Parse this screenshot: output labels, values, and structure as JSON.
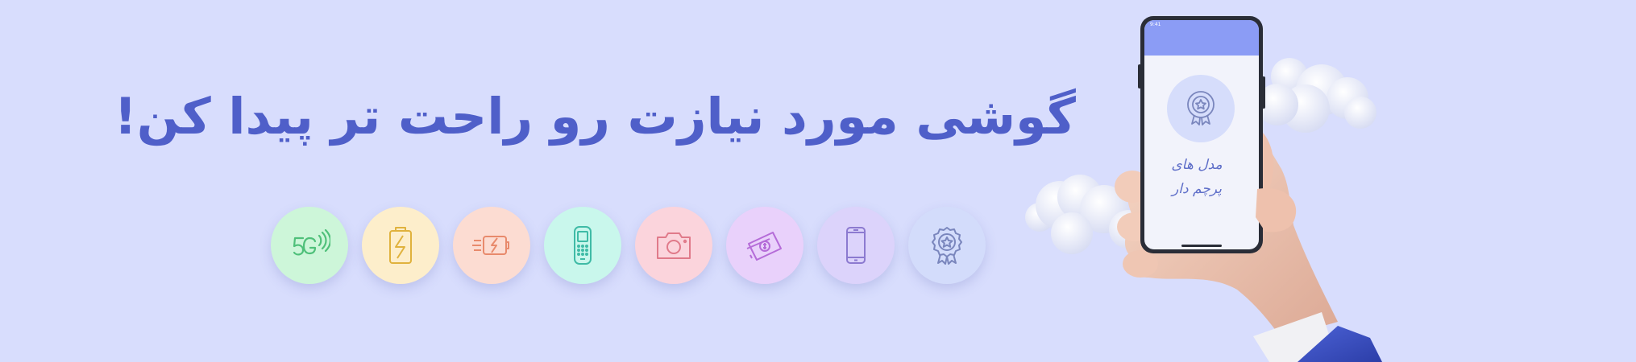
{
  "banner": {
    "headline": "گوشی مورد نیازت رو راحت تر پیدا کن!",
    "background_color": "#d8ddfd",
    "headline_color": "#4f5fc9"
  },
  "features": [
    {
      "icon": "award-badge-icon",
      "bg": "#d3dcfb",
      "stroke": "#7a86bd"
    },
    {
      "icon": "smartphone-icon",
      "bg": "#dcd3fb",
      "stroke": "#8c7ad0"
    },
    {
      "icon": "money-cash-icon",
      "bg": "#e9d1fb",
      "stroke": "#b56cd8"
    },
    {
      "icon": "camera-icon",
      "bg": "#fbd4dc",
      "stroke": "#e07a8a"
    },
    {
      "icon": "feature-phone-icon",
      "bg": "#c9f7ec",
      "stroke": "#3fbba6"
    },
    {
      "icon": "fast-charging-battery-icon",
      "bg": "#fcdcd2",
      "stroke": "#e88a6c"
    },
    {
      "icon": "battery-bolt-icon",
      "bg": "#fdeecb",
      "stroke": "#e0b23d"
    },
    {
      "icon": "5g-icon",
      "bg": "#cdf6d9",
      "stroke": "#4fc07a"
    }
  ],
  "phone": {
    "status_time": "9:41",
    "screen_label_line1": "مدل های",
    "screen_label_line2": "پرچم دار"
  }
}
